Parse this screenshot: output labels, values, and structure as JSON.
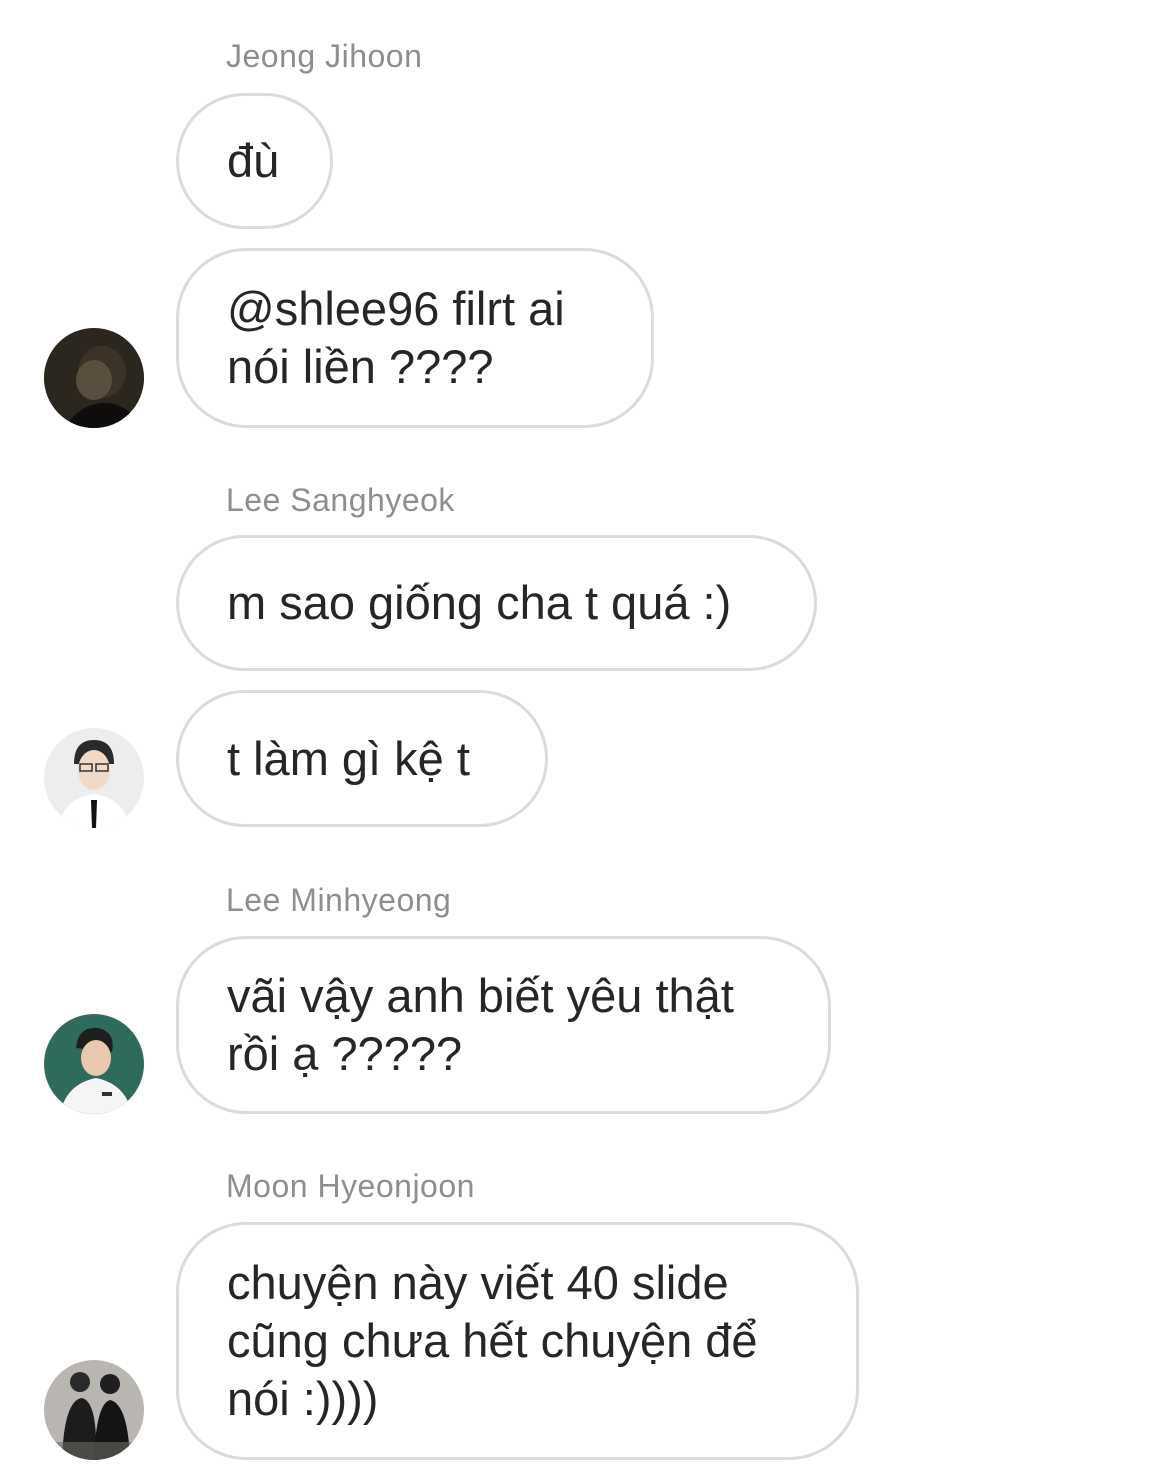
{
  "messages": [
    {
      "sender": "Jeong Jihoon",
      "bubbles": [
        "đù",
        "@shlee96 filrt ai\nnói liền ????"
      ],
      "avatar": "profile-avatar-jeong-jihoon"
    },
    {
      "sender": "Lee Sanghyeok",
      "bubbles": [
        "m sao giống cha t quá :)",
        "t làm gì kệ t"
      ],
      "avatar": "profile-avatar-lee-sanghyeok"
    },
    {
      "sender": "Lee Minhyeong",
      "bubbles": [
        "vãi vậy anh biết yêu thật\nrồi ạ ?????"
      ],
      "avatar": "profile-avatar-lee-minhyeong"
    },
    {
      "sender": "Moon Hyeonjoon",
      "bubbles": [
        "chuyện này viết 40 slide\ncũng chưa hết chuyện để\nnói :))))"
      ],
      "avatar": "profile-avatar-moon-hyeonjoon"
    }
  ],
  "colors": {
    "sender_name": "#8e8e8e",
    "bubble_border": "#dbdbdb",
    "text": "#262626",
    "background": "#ffffff"
  }
}
